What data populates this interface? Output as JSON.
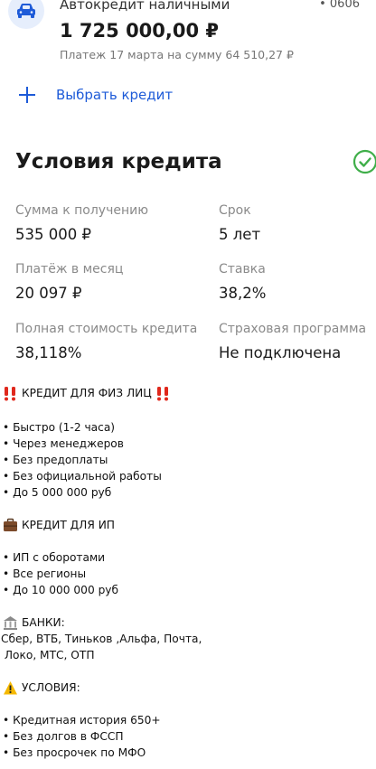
{
  "loan_card": {
    "title": "Автокредит наличными",
    "account_mask": "• 0606",
    "amount": "1 725 000,00 ₽",
    "payment_note": "Платеж 17 марта на сумму 64 510,27 ₽",
    "icon": "car-icon",
    "accent": "#1e5bd8"
  },
  "choose_credit": {
    "label": "Выбрать кредит",
    "icon": "plus-icon"
  },
  "conditions": {
    "title": "Условия кредита",
    "status_icon": "check-circle-icon",
    "status_color": "#3fae49",
    "items": [
      {
        "label": "Сумма к получению",
        "value": "535 000 ₽"
      },
      {
        "label": "Срок",
        "value": "5 лет"
      },
      {
        "label": "Платёж в месяц",
        "value": "20 097 ₽"
      },
      {
        "label": "Ставка",
        "value": "38,2%"
      },
      {
        "label": "Полная стоимость кредита",
        "value": "38,118%"
      },
      {
        "label": "Страховая программа",
        "value": "Не подключена"
      }
    ]
  },
  "post": {
    "heading1": "КРЕДИТ ДЛЯ ФИЗ ЛИЦ",
    "list1": [
      "• Быстро (1-2 часа)",
      "• Через менеджеров",
      "• Без предоплаты",
      "• Без официальной работы",
      "• До 5 000 000 руб"
    ],
    "heading2": "КРЕДИТ ДЛЯ ИП",
    "list2": [
      "• ИП с оборотами",
      "• Все регионы",
      "• До 10 000 000 руб"
    ],
    "heading3": "БАНКИ:",
    "banks": [
      "Сбер, ВТБ, Тиньков ,Альфа, Почта,",
      " Локо, МТС, ОТП"
    ],
    "heading4": "УСЛОВИЯ:",
    "list4": [
      "• Кредитная история 650+",
      "• Без долгов в ФССП",
      "• Без просрочек по МФО"
    ]
  }
}
